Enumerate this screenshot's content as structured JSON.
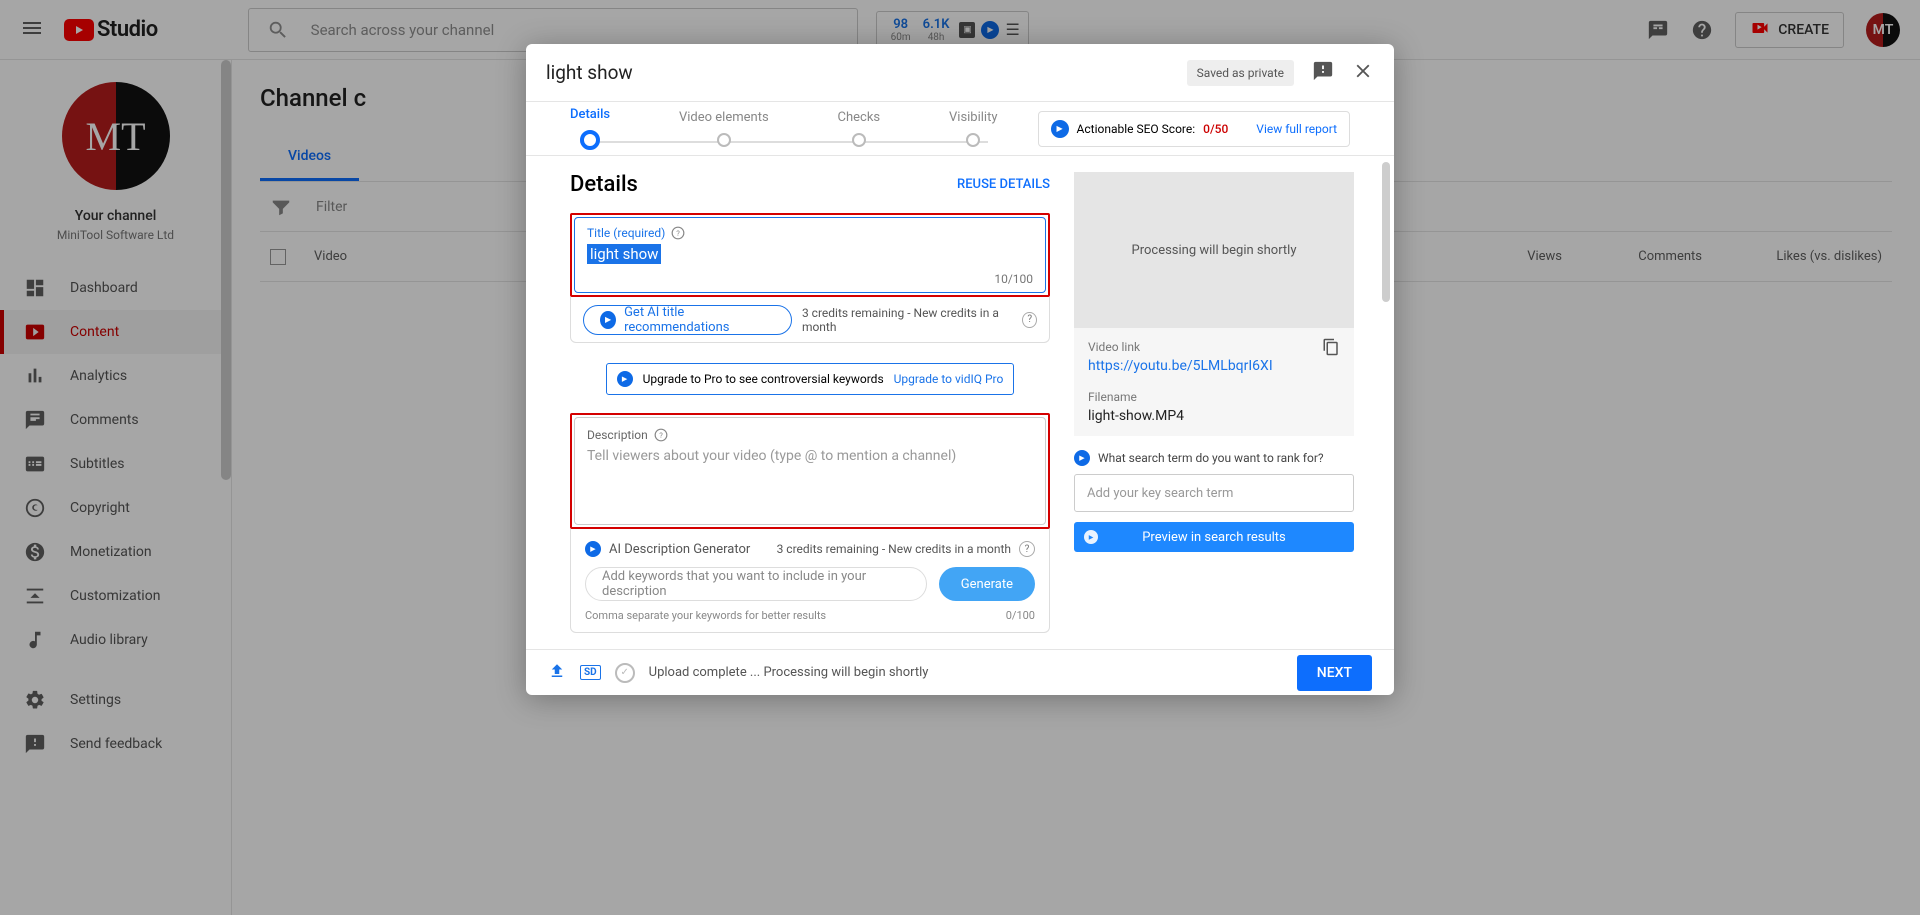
{
  "topbar": {
    "search_placeholder": "Search across your channel",
    "ext": {
      "n1": "98",
      "s1": "60m",
      "n2": "6.1K",
      "s2": "48h"
    },
    "create_label": "CREATE",
    "avatar_initials": "MT"
  },
  "sidebar": {
    "avatar_initials": "MT",
    "your_channel": "Your channel",
    "channel_name": "MiniTool Software Ltd",
    "items": [
      {
        "label": "Dashboard"
      },
      {
        "label": "Content"
      },
      {
        "label": "Analytics"
      },
      {
        "label": "Comments"
      },
      {
        "label": "Subtitles"
      },
      {
        "label": "Copyright"
      },
      {
        "label": "Monetization"
      },
      {
        "label": "Customization"
      },
      {
        "label": "Audio library"
      },
      {
        "label": "Settings"
      },
      {
        "label": "Send feedback"
      }
    ]
  },
  "main": {
    "title": "Channel c",
    "tab_videos": "Videos",
    "filter_label": "Filter",
    "col_video": "Video",
    "col_views": "Views",
    "col_comments": "Comments",
    "col_likes": "Likes (vs. dislikes)"
  },
  "modal": {
    "title": "light show",
    "saved_chip": "Saved as private",
    "steps": {
      "s1": "Details",
      "s2": "Video elements",
      "s3": "Checks",
      "s4": "Visibility"
    },
    "seo": {
      "label": "Actionable SEO Score:",
      "score": "0/50",
      "link": "View full report"
    },
    "details_heading": "Details",
    "reuse": "REUSE DETAILS",
    "title_field": {
      "label": "Title (required)",
      "value": "light show",
      "counter": "10/100"
    },
    "ai_title": {
      "button": "Get AI title recommendations",
      "credits": "3 credits remaining - New credits in a month"
    },
    "upgrade": {
      "text": "Upgrade to Pro to see controversial keywords",
      "link": "Upgrade to vidIQ Pro"
    },
    "desc_field": {
      "label": "Description",
      "placeholder": "Tell viewers about your video (type @ to mention a channel)"
    },
    "ai_desc": {
      "title": "AI Description Generator",
      "credits": "3 credits remaining - New credits in a month",
      "kw_placeholder": "Add keywords that you want to include in your description",
      "generate": "Generate",
      "hint": "Comma separate your keywords for better results",
      "counter": "0/100"
    },
    "preview": {
      "processing": "Processing will begin shortly",
      "video_link_label": "Video link",
      "video_link": "https://youtu.be/5LMLbqrI6XI",
      "filename_label": "Filename",
      "filename": "light-show.MP4"
    },
    "search": {
      "question": "What search term do you want to rank for?",
      "placeholder": "Add your key search term",
      "button": "Preview in search results"
    },
    "footer": {
      "sd": "SD",
      "status": "Upload complete ... Processing will begin shortly",
      "next": "NEXT"
    }
  }
}
